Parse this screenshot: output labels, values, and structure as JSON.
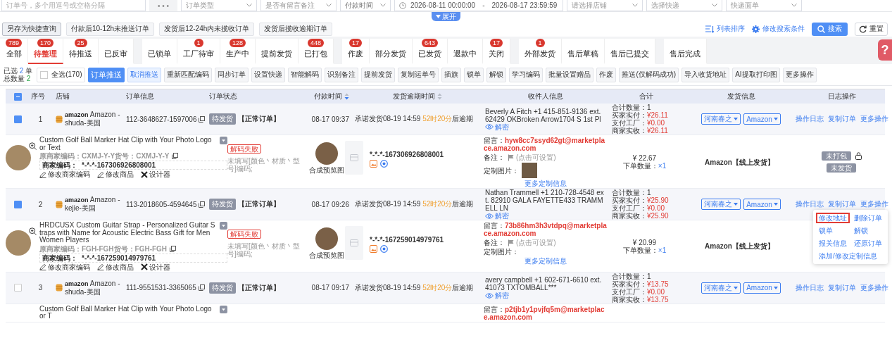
{
  "filters": [
    {
      "kind": "input",
      "placeholder": "订单号，多个用逗号或空格分隔"
    },
    {
      "kind": "more",
      "label": "• • •"
    },
    {
      "kind": "select",
      "placeholder": "订单类型"
    },
    {
      "kind": "select",
      "placeholder": "是否有留言备注"
    },
    {
      "kind": "select",
      "value": "付款时间"
    },
    {
      "kind": "daterange",
      "start": "2026-08-11 00:00:00",
      "separator": "-",
      "end": "2026-08-17 23:59:59"
    },
    {
      "kind": "select",
      "placeholder": "请选择店铺"
    },
    {
      "kind": "select",
      "placeholder": "选择快递"
    },
    {
      "kind": "select",
      "placeholder": "快递面单"
    }
  ],
  "expand_toggle": "展开",
  "quick_queries": [
    {
      "kind": "save",
      "label": "另存为快捷查询"
    },
    {
      "kind": "preset",
      "label": "付款后10-12h未推送订单"
    },
    {
      "kind": "preset",
      "label": "发货后12-24h内未揽收订单"
    },
    {
      "kind": "preset",
      "label": "发货后揽收逾期订单"
    }
  ],
  "toolbar": [
    {
      "kind": "link",
      "label": "列表排序"
    },
    {
      "kind": "link",
      "label": "修改搜索条件"
    },
    {
      "kind": "primary",
      "label": "搜索"
    },
    {
      "kind": "default",
      "label": "重置"
    }
  ],
  "help_button": "?",
  "tab_groups": [
    [
      {
        "label": "全部",
        "count": "789",
        "selected": false
      },
      {
        "label": "待整理",
        "count": "170",
        "selected": true
      },
      {
        "label": "待推送",
        "count": "25",
        "selected": false
      },
      {
        "label": "已反审",
        "selected": false
      }
    ],
    [
      {
        "label": "已锁单",
        "selected": false
      },
      {
        "label": "工厂待审",
        "count": "1",
        "selected": false
      },
      {
        "label": "生产中",
        "count": "128",
        "selected": false
      },
      {
        "label": "提前发货",
        "selected": false
      },
      {
        "label": "已打包",
        "count": "448",
        "selected": false
      }
    ],
    [
      {
        "label": "作废",
        "count": "17",
        "selected": false
      },
      {
        "label": "部分发货",
        "selected": false
      },
      {
        "label": "已发货",
        "count": "643",
        "selected": false
      },
      {
        "label": "退款中",
        "selected": false
      },
      {
        "label": "关闭",
        "count": "17",
        "selected": false
      }
    ],
    [
      {
        "label": "外部发货",
        "count": "1",
        "selected": false
      },
      {
        "label": "售后草稿",
        "selected": false
      },
      {
        "label": "售后已提交",
        "selected": false
      }
    ],
    [
      {
        "label": "售后完成",
        "selected": false
      }
    ]
  ],
  "selection_summary": {
    "selected_label": "已选",
    "selected_count": "2",
    "selected_unit": "单",
    "total_label": "总数量",
    "total_count": "2"
  },
  "select_all": {
    "label": "全选(170)",
    "checked": false
  },
  "actions": [
    {
      "kind": "primary",
      "label": "订单推送"
    },
    {
      "kind": "light",
      "label": "取消推送"
    },
    {
      "kind": "default",
      "label": "重新匹配编码"
    },
    {
      "kind": "default",
      "label": "同步订单"
    },
    {
      "kind": "default",
      "label": "设置快递"
    },
    {
      "kind": "default",
      "label": "智能解码"
    },
    {
      "kind": "default",
      "label": "识别备注"
    },
    {
      "kind": "default",
      "label": "提前发货"
    },
    {
      "kind": "default",
      "label": "复制运单号"
    },
    {
      "kind": "default",
      "label": "插旗"
    },
    {
      "kind": "default",
      "label": "锁单"
    },
    {
      "kind": "default",
      "label": "解锁"
    },
    {
      "kind": "default",
      "label": "学习编码"
    },
    {
      "kind": "default",
      "label": "批量设置赠品"
    },
    {
      "kind": "default",
      "label": "作废"
    },
    {
      "kind": "default",
      "label": "推送(仅解码成功)"
    },
    {
      "kind": "default",
      "label": "导入收货地址"
    },
    {
      "kind": "default",
      "label": "AI提取打印图"
    },
    {
      "kind": "default",
      "label": "更多操作"
    }
  ],
  "table": {
    "header_indeterminate": true,
    "columns": [
      {
        "label": "序号"
      },
      {
        "label": "店铺"
      },
      {
        "label": "订单信息"
      },
      {
        "label": "订单状态"
      },
      {
        "label": "付款时间",
        "sortable": true,
        "sorted": true
      },
      {
        "label": "发货逾期时间",
        "sortable": true,
        "sorted": false
      },
      {
        "label": "收件人信息"
      },
      {
        "label": "合计"
      },
      {
        "label": "发货信息"
      },
      {
        "label": "日志操作"
      }
    ]
  },
  "orders": [
    {
      "checked": true,
      "index": "1",
      "shop_brand": "amazon",
      "shop": "Amazon - shuda-美国",
      "order_no": "112-3648627-1597006",
      "status_tag": "待发货",
      "order_type": "【正常订单】",
      "paid_time": "08-17 09:37",
      "promise": "承诺发货08-19 14:59",
      "remaining": "52时20分",
      "overdue_suffix": "后逾期",
      "recipient": "Beverly A Fitch  +1 415-851-9136 ext. 62429  OKBroken Arrow1704 S 1st Pl",
      "decrypt": "解密",
      "totals": [
        {
          "label": "合计数量：",
          "value": "1"
        },
        {
          "label": "买家实付：",
          "value": "¥26.11"
        },
        {
          "label": "支付工厂：",
          "value": "¥0.00"
        },
        {
          "label": "商家实收：",
          "value": "¥26.11"
        }
      ],
      "warehouse": "河南春之",
      "carrier": "Amazon",
      "log_actions": [
        "操作日志",
        "复制订单",
        "更多操作"
      ],
      "item": {
        "title": "Custom Golf Ball Marker Hat Clip with Your Photo Logo or Text",
        "original_code": "原商家编码：CXMJ-Y-Y货号：CXMJ-Y-Y",
        "merchant_code_label": "商家编码：",
        "merchant_code": "*-*-*-167306926808001",
        "links": [
          "修改商家编码",
          "修改商品",
          "设计器"
        ],
        "decode_status": "解码失败",
        "decode_note": "未填写[颜色丶材质丶型号]编码;",
        "preview_caption": "合成预览图",
        "code": "*-*-*-167306926808001",
        "message_label": "留言：",
        "message": "hyw8cc7ssyd62gt@marketplace.amazon.com",
        "remark_label": "备注：",
        "remark_hint": "(点击可设置)",
        "custom_image_label": "定制图片：",
        "custom_image": true,
        "more_custom": "更多定制信息",
        "price": "¥ 22.67",
        "qty_label": "下单数量：",
        "qty": "×1",
        "shipping": "Amazon【线上发货】",
        "tags": [
          "未打包",
          "未发货"
        ],
        "locked": true
      }
    },
    {
      "checked": true,
      "index": "2",
      "shop_brand": "amazon",
      "shop": "Amazon - kejie-美国",
      "order_no": "113-2018605-4594645",
      "status_tag": "待发货",
      "order_type": "【正常订单】",
      "paid_time": "08-17 09:26",
      "promise": "承诺发货08-19 14:59",
      "remaining": "52时20分",
      "overdue_suffix": "后逾期",
      "recipient": "Nathan Trammell  +1 210-728-4548 ext. 82910  GALA FAYETTE433 TRAMMELL LN",
      "decrypt": "解密",
      "totals": [
        {
          "label": "合计数量：",
          "value": "1"
        },
        {
          "label": "买家实付：",
          "value": "¥25.90"
        },
        {
          "label": "支付工厂：",
          "value": "¥0.00"
        },
        {
          "label": "商家实收：",
          "value": "¥25.90"
        }
      ],
      "warehouse": "河南春之",
      "carrier": "Amazon",
      "log_actions": [
        "操作日志",
        "复制订单",
        "更多操作"
      ],
      "more_menu": [
        {
          "label": "修改地址",
          "highlighted": true
        },
        {
          "label": "删除订单",
          "highlighted": false
        },
        {
          "label": "锁单",
          "highlighted": false
        },
        {
          "label": "解锁",
          "highlighted": false
        },
        {
          "label": "报关信息",
          "highlighted": false
        },
        {
          "label": "还原订单",
          "highlighted": false
        },
        {
          "label": "添加/修改定制信息",
          "highlighted": false
        }
      ],
      "item": {
        "title": "HRDCUSX Custom Guitar Strap - Personalized Guitar Straps with Name for Acoustic Electric Bass Gift for Men Women Players",
        "original_code": "原商家编码：FGH-FGH货号：FGH-FGH",
        "merchant_code_label": "商家编码：",
        "merchant_code": "*-*-*-167259014979761",
        "links": [
          "修改商家编码",
          "修改商品",
          "设计器"
        ],
        "decode_status": "解码失败",
        "decode_note": "未填写[颜色丶材质丶型号]编码;",
        "preview_caption": "合成预览图",
        "code": "*-*-*-167259014979761",
        "message_label": "留言：",
        "message": "73b86hm3h3vtdpq@marketplace.amazon.com",
        "remark_label": "备注：",
        "remark_hint": "(点击可设置)",
        "custom_image_label": "定制图片：",
        "custom_image": false,
        "more_custom": "更多定制信息",
        "price": "¥ 20.99",
        "qty_label": "下单数量：",
        "qty": "×1",
        "shipping": "Amazon【线上发货】",
        "locked": false
      }
    },
    {
      "checked": false,
      "index": "3",
      "shop_brand": "amazon",
      "shop": "Amazon - shuda-美国",
      "order_no": "111-9551531-3365065",
      "status_tag": "待发货",
      "order_type": "【正常订单】",
      "paid_time": "08-17 09:17",
      "promise": "承诺发货08-19 14:59",
      "remaining": "52时20分",
      "overdue_suffix": "后逾期",
      "recipient": "avery campbell  +1 602-671-6610 ext. 41073  TXTOMBALL***",
      "decrypt": "解密",
      "totals": [
        {
          "label": "合计数量：",
          "value": "1"
        },
        {
          "label": "买家实付：",
          "value": "¥13.75"
        },
        {
          "label": "支付工厂：",
          "value": "¥0.00"
        },
        {
          "label": "商家实收：",
          "value": "¥13.75"
        }
      ],
      "warehouse": "河南春之",
      "carrier": "Amazon",
      "log_actions": [
        "操作日志",
        "复制订单",
        "更多操作"
      ],
      "item": {
        "title": "Custom Golf Ball Marker Hat Clip with Your Photo Logo or T",
        "message_label": "留言：",
        "message": "p2tjb1y1pvjfq5m@marketplace.amazon.com"
      }
    }
  ]
}
